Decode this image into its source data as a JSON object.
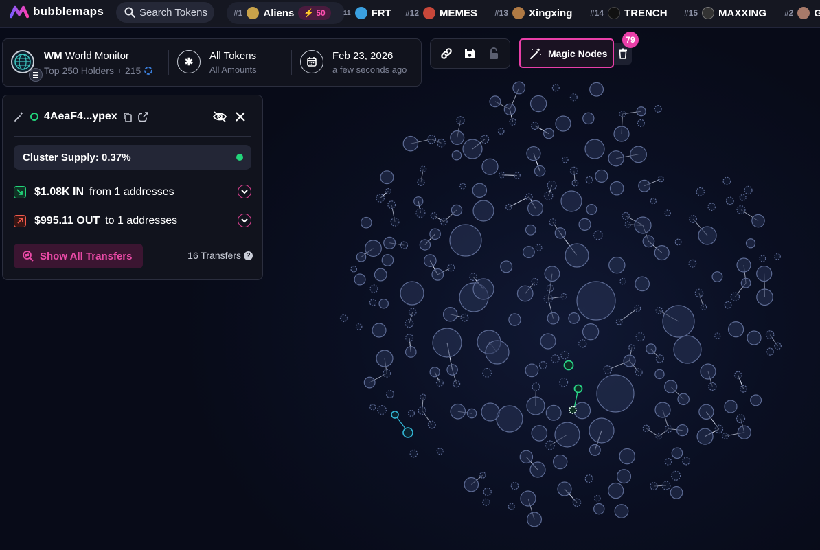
{
  "app": {
    "name": "bubblemaps"
  },
  "search": {
    "label": "Search Tokens"
  },
  "ticker": [
    {
      "rank": "#1",
      "name": "Aliens",
      "boost": "50",
      "avatar_color": "#c8a24a"
    },
    {
      "rank": "#11",
      "name": "FRT",
      "avatar_color": "#3aa0e0"
    },
    {
      "rank": "#12",
      "name": "MEMES",
      "avatar_color": "#c7473a"
    },
    {
      "rank": "#13",
      "name": "Xingxing",
      "avatar_color": "#b07a44"
    },
    {
      "rank": "#14",
      "name": "TRENCH",
      "avatar_color": "#111111"
    },
    {
      "rank": "#15",
      "name": "MAXXING",
      "avatar_color": "#333333"
    },
    {
      "rank": "#2",
      "name": "G",
      "avatar_color": "#a87a6a"
    }
  ],
  "token": {
    "symbol": "WM",
    "name": "World Monitor",
    "holders_label": "Top 250 Holders + 215"
  },
  "filter": {
    "title": "All Tokens",
    "subtitle": "All Amounts"
  },
  "date": {
    "title": "Feb 23, 2026",
    "subtitle": "a few seconds ago"
  },
  "tools": {
    "link_icon": "link-icon",
    "save_icon": "save-icon",
    "lock_icon": "lock-icon"
  },
  "magic": {
    "label": "Magic Nodes",
    "count": "79"
  },
  "panel": {
    "address": "4AeaF4...ypex",
    "supply_label": "Cluster Supply: 0.37%",
    "in_amount": "$1.08K IN",
    "in_text": "from 1 addresses",
    "out_amount": "$995.11 OUT",
    "out_text": "to 1 addresses",
    "show_all": "Show All Transfers",
    "transfers": "16 Transfers",
    "help": "?"
  },
  "colors": {
    "accent": "#e93fa8",
    "green": "#22d47a",
    "node_fill": "#2a3558",
    "node_stroke": "#5d6b94",
    "highlight": "#2ad487",
    "cyan": "#33b8d8"
  }
}
